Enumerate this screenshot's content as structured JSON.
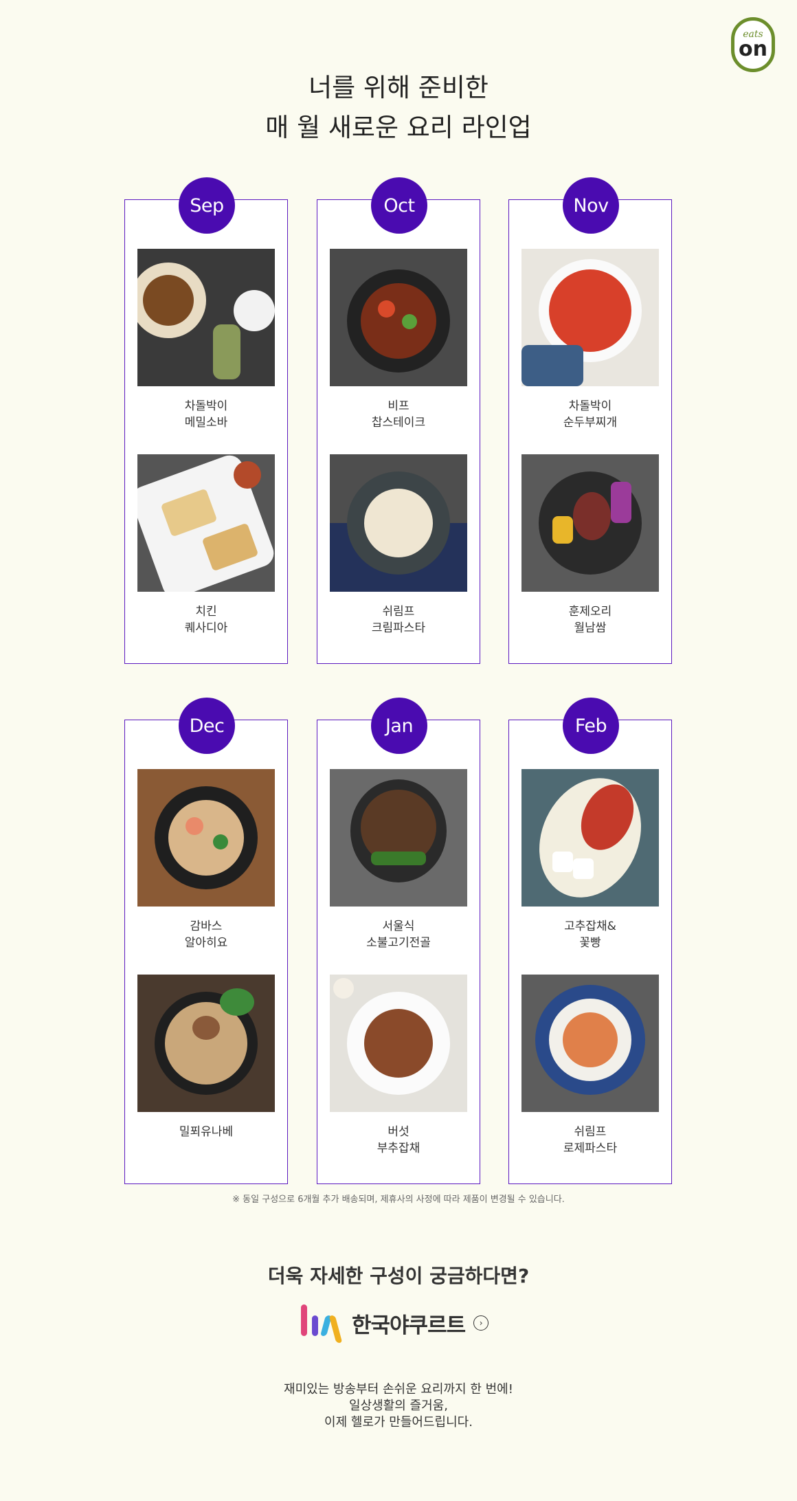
{
  "logo": {
    "small": "eats",
    "big": "on"
  },
  "title": {
    "line1": "너를 위해 준비한",
    "line2": "매 월 새로운 요리 라인업"
  },
  "months": [
    {
      "month": "Sep",
      "dishes": [
        {
          "line1": "차돌박이",
          "line2": "메밀소바"
        },
        {
          "line1": "치킨",
          "line2": "퀘사디아"
        }
      ]
    },
    {
      "month": "Oct",
      "dishes": [
        {
          "line1": "비프",
          "line2": "찹스테이크"
        },
        {
          "line1": "쉬림프",
          "line2": "크림파스타"
        }
      ]
    },
    {
      "month": "Nov",
      "dishes": [
        {
          "line1": "차돌박이",
          "line2": "순두부찌개"
        },
        {
          "line1": "훈제오리",
          "line2": "월남쌈"
        }
      ]
    },
    {
      "month": "Dec",
      "dishes": [
        {
          "line1": "감바스",
          "line2": "알아히요"
        },
        {
          "line1": "밀푀유나베",
          "line2": ""
        }
      ]
    },
    {
      "month": "Jan",
      "dishes": [
        {
          "line1": "서울식",
          "line2": "소불고기전골"
        },
        {
          "line1": "버섯",
          "line2": "부추잡채"
        }
      ]
    },
    {
      "month": "Feb",
      "dishes": [
        {
          "line1": "고추잡채&",
          "line2": "꽃빵"
        },
        {
          "line1": "쉬림프",
          "line2": "로제파스타"
        }
      ]
    }
  ],
  "note": "※ 동일 구성으로 6개월 추가 배송되며, 제휴사의 사정에 따라 제품이 변경될 수 있습니다.",
  "question": "더욱 자세한 구성이 궁금하다면?",
  "brand": {
    "name": "한국야쿠르트",
    "arrow": "›"
  },
  "tagline": {
    "line1": "재미있는 방송부터 손쉬운 요리까지 한 번에!",
    "line2": "일상생활의 즐거움,",
    "line3": "이제 헬로가 만들어드립니다."
  },
  "colors": {
    "accent": "#4a0bb0",
    "border": "#5a17bf",
    "background": "#fbfbf0",
    "logo_green": "#6c8e2c"
  }
}
